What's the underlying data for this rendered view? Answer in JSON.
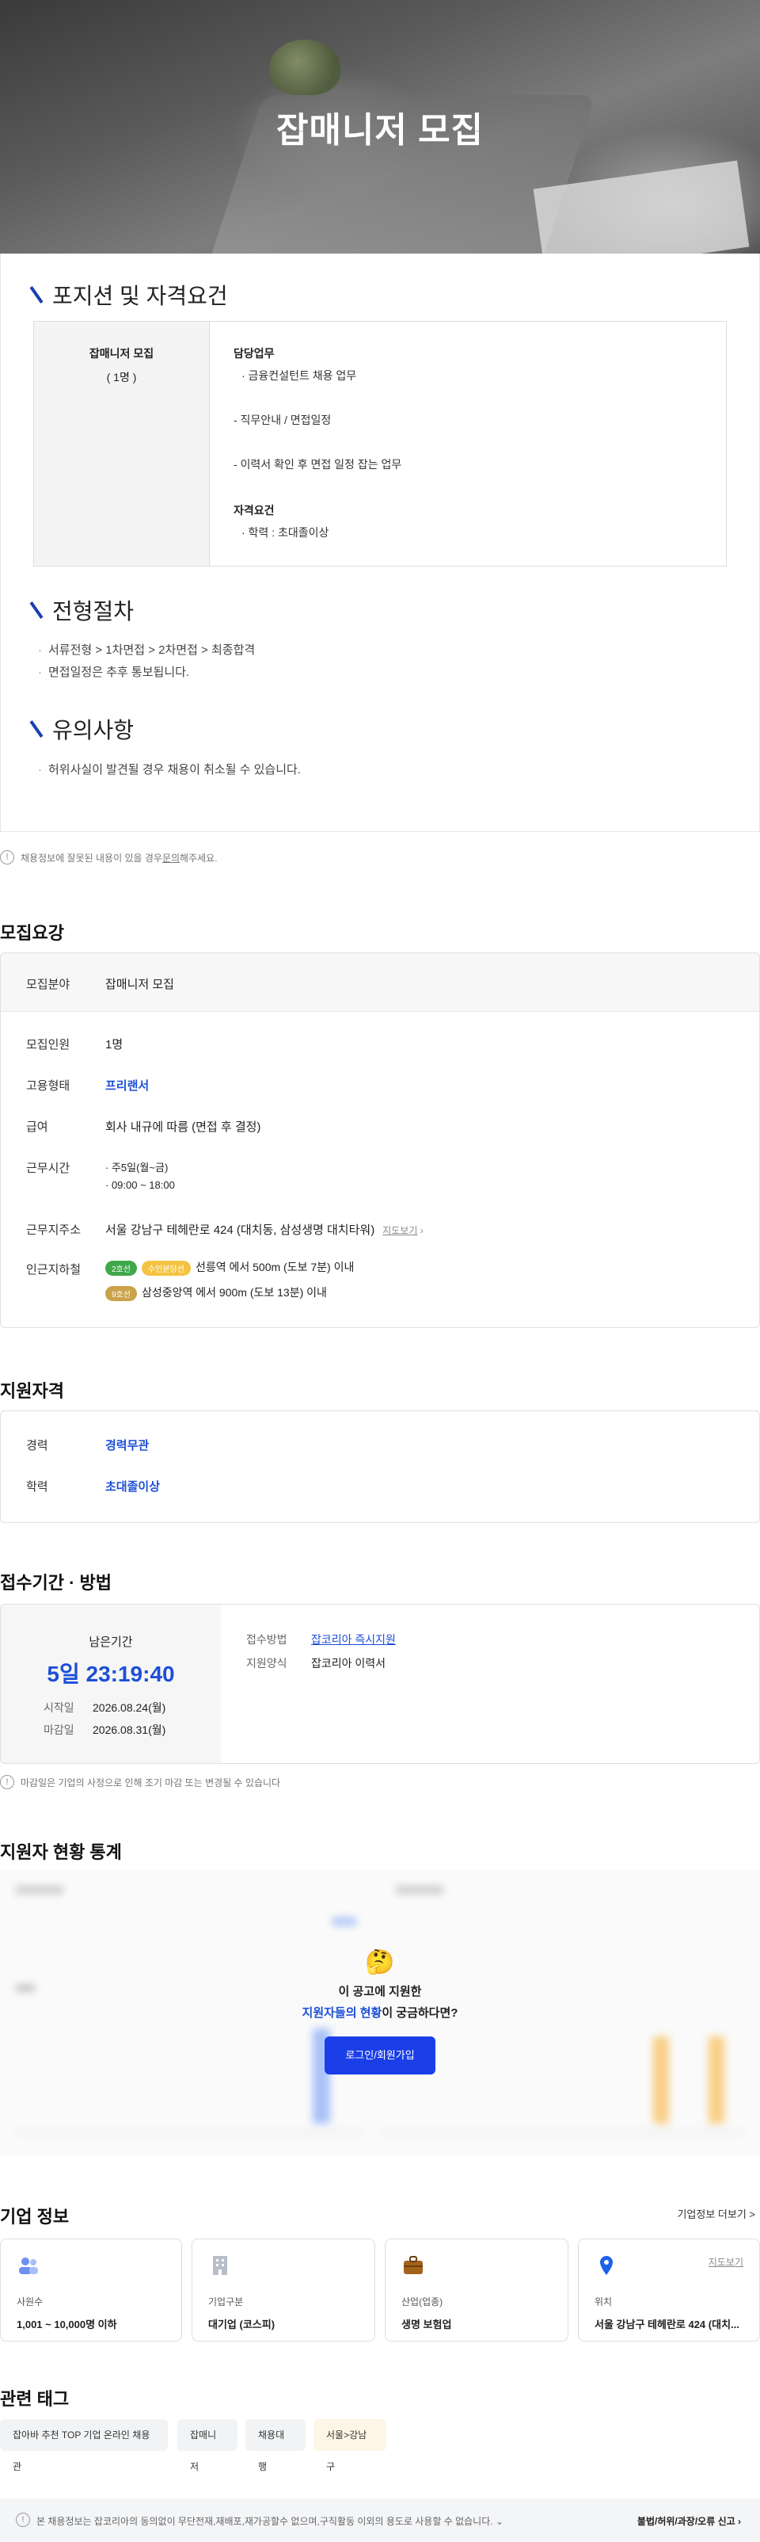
{
  "hero": {
    "title": "잡매니저 모집"
  },
  "sections": {
    "position": {
      "heading": "포지션 및 자격요건",
      "role": "잡매니저 모집",
      "count": "( 1명 )",
      "duty_title": "담당업무",
      "duty_items": [
        "· 금융컨설턴트 채용 업무",
        "- 직무안내 / 면접일정",
        "- 이력서 확인 후 면접 일정 잡는 업무"
      ],
      "qual_title": "자격요건",
      "qual_items": [
        "· 학력 : 초대졸이상"
      ]
    },
    "process": {
      "heading": "전형절차",
      "items": [
        "서류전형 > 1차면접 > 2차면접 > 최종합격",
        "면접일정은 추후 통보됩니다."
      ]
    },
    "caution": {
      "heading": "유의사항",
      "items": [
        "허위사실이 발견될 경우 채용이 취소될 수 있습니다."
      ]
    }
  },
  "report_notice": {
    "prefix": "채용정보에 잘못된 내용이 있을 경우 ",
    "link": "문의",
    "suffix": "해주세요."
  },
  "recruit": {
    "title": "모집요강",
    "field_label": "모집분야",
    "field_value": "잡매니저 모집",
    "people_label": "모집인원",
    "people_value": "1명",
    "type_label": "고용형태",
    "type_value": "프리랜서",
    "pay_label": "급여",
    "pay_value": "회사 내규에 따름 (면접 후 결정)",
    "hours_label": "근무시간",
    "hours_days": "주5일(월~금)",
    "hours_time": "09:00 ~ 18:00",
    "addr_label": "근무지주소",
    "addr_value": "서울 강남구 테헤란로 424 (대치동, 삼성생명 대치타워)",
    "map_link": "지도보기",
    "subway_label": "인근지하철",
    "subway": [
      {
        "line": "2호선",
        "line2": "수인분당선",
        "text": "선릉역 에서 500m (도보 7분) 이내"
      },
      {
        "line": "9호선",
        "text": "삼성중앙역 에서 900m (도보 13분) 이내"
      }
    ]
  },
  "qualification": {
    "title": "지원자격",
    "career_label": "경력",
    "career_value": "경력무관",
    "edu_label": "학력",
    "edu_value": "초대졸이상"
  },
  "apply": {
    "title": "접수기간 · 방법",
    "remain_label": "남은기간",
    "remain_value": "5일 23:19:40",
    "start_label": "시작일",
    "start_value": "2026.08.24(월)",
    "end_label": "마감일",
    "end_value": "2026.08.31(월)",
    "method_label": "접수방법",
    "method_value": "잡코리아 즉시지원",
    "form_label": "지원양식",
    "form_value": "잡코리아 이력서",
    "notice": "마감일은 기업의 사정으로 인해 조기 마감 또는 변경될 수 있습니다"
  },
  "stats": {
    "title": "지원자 현황 통계",
    "prompt_line1": "이 공고에 지원한",
    "prompt_highlight": "지원자들의 현황",
    "prompt_rest": "이 궁금하다면?",
    "login_button": "로그인/회원가입"
  },
  "company": {
    "title": "기업 정보",
    "more": "기업정보 더보기 >",
    "cards": [
      {
        "icon": "people-icon",
        "label": "사원수",
        "value": "1,001 ~ 10,000명 이하"
      },
      {
        "icon": "building-icon",
        "label": "기업구분",
        "value": "대기업 (코스피)"
      },
      {
        "icon": "briefcase-icon",
        "label": "산업(업종)",
        "value": "생명 보험업"
      },
      {
        "icon": "location-pin-icon",
        "label": "위치",
        "value": "서울 강남구 테헤란로 424 (대치...",
        "link": "지도보기"
      }
    ]
  },
  "tags": {
    "title": "관련 태그",
    "items": [
      "잡아바 추천 TOP 기업 온라인 채용관",
      "잡매니저",
      "채용대행",
      "서울>강남구"
    ]
  },
  "footer": {
    "copyright": "본 채용정보는 잡코리아의 동의없이 무단전재,재배포,재가공할수 없으며,구직활동 이외의 용도로 사용할 수 없습니다.",
    "report": "불법/허위/과장/오류 신고"
  },
  "colors": {
    "accent": "#1c4fd8",
    "button": "#1a3fe8",
    "line2": "#3fa84a",
    "bundang": "#f5c343",
    "line9": "#c9a24a"
  }
}
